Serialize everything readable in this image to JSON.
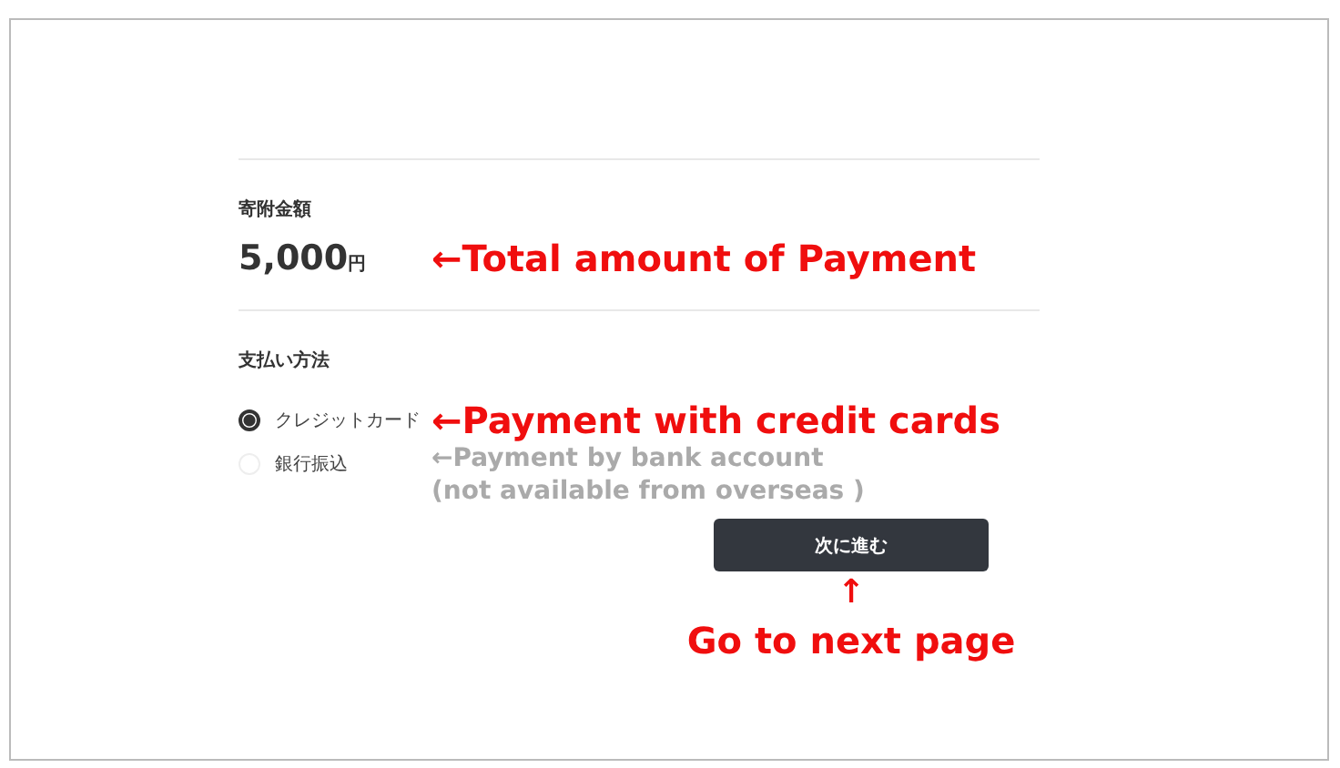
{
  "amount_section": {
    "label": "寄附金額",
    "amount": "5,000",
    "currency": "円",
    "annotation": "←Total amount of Payment"
  },
  "payment_section": {
    "label": "支払い方法",
    "options": [
      {
        "label": "クレジットカード",
        "selected": true,
        "annotation_lines": [
          "←Payment with credit cards"
        ],
        "kind": "primary"
      },
      {
        "label": "銀行振込",
        "selected": false,
        "annotation_lines": [
          "←Payment by bank account",
          "(not available from overseas )"
        ],
        "kind": "secondary"
      }
    ]
  },
  "next_button": {
    "label": "次に進む",
    "annotation_arrow": "↑",
    "annotation": "Go to next page"
  }
}
